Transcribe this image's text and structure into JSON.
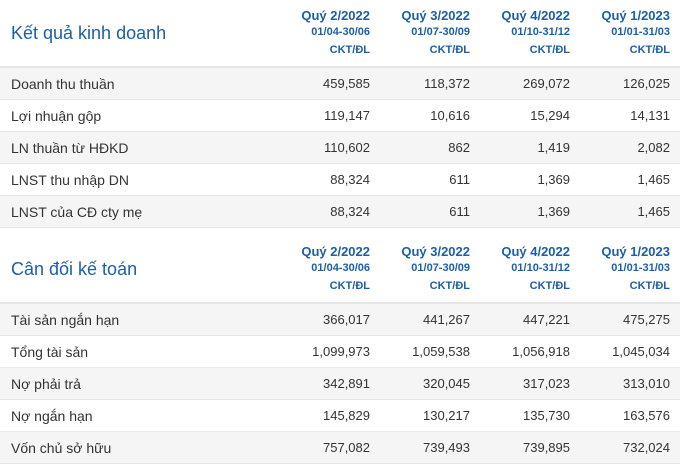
{
  "income": {
    "title": "Kết quả kinh doanh",
    "columns": [
      {
        "quarter": "Quý 2/2022",
        "dates": "01/04-30/06",
        "audit": "CKT/ĐL"
      },
      {
        "quarter": "Quý 3/2022",
        "dates": "01/07-30/09",
        "audit": "CKT/ĐL"
      },
      {
        "quarter": "Quý 4/2022",
        "dates": "01/10-31/12",
        "audit": "CKT/ĐL"
      },
      {
        "quarter": "Quý 1/2023",
        "dates": "01/01-31/03",
        "audit": "CKT/ĐL"
      }
    ],
    "rows": [
      {
        "label": "Doanh thu thuần",
        "values": [
          "459,585",
          "118,372",
          "269,072",
          "126,025"
        ]
      },
      {
        "label": "Lợi nhuận gộp",
        "values": [
          "119,147",
          "10,616",
          "15,294",
          "14,131"
        ]
      },
      {
        "label": "LN thuần từ HĐKD",
        "values": [
          "110,602",
          "862",
          "1,419",
          "2,082"
        ]
      },
      {
        "label": "LNST thu nhập DN",
        "values": [
          "88,324",
          "611",
          "1,369",
          "1,465"
        ]
      },
      {
        "label": "LNST của CĐ cty mẹ",
        "values": [
          "88,324",
          "611",
          "1,369",
          "1,465"
        ]
      }
    ]
  },
  "balance": {
    "title": "Cân đối kế toán",
    "columns": [
      {
        "quarter": "Quý 2/2022",
        "dates": "01/04-30/06",
        "audit": "CKT/ĐL"
      },
      {
        "quarter": "Quý 3/2022",
        "dates": "01/07-30/09",
        "audit": "CKT/ĐL"
      },
      {
        "quarter": "Quý 4/2022",
        "dates": "01/10-31/12",
        "audit": "CKT/ĐL"
      },
      {
        "quarter": "Quý 1/2023",
        "dates": "01/01-31/03",
        "audit": "CKT/ĐL"
      }
    ],
    "rows": [
      {
        "label": "Tài sản ngắn hạn",
        "values": [
          "366,017",
          "441,267",
          "447,221",
          "475,275"
        ]
      },
      {
        "label": "Tổng tài sản",
        "values": [
          "1,099,973",
          "1,059,538",
          "1,056,918",
          "1,045,034"
        ]
      },
      {
        "label": "Nợ phải trả",
        "values": [
          "342,891",
          "320,045",
          "317,023",
          "313,010"
        ]
      },
      {
        "label": "Nợ ngắn hạn",
        "values": [
          "145,829",
          "130,217",
          "135,730",
          "163,576"
        ]
      },
      {
        "label": "Vốn chủ sở hữu",
        "values": [
          "757,082",
          "739,493",
          "739,895",
          "732,024"
        ]
      }
    ]
  },
  "colors": {
    "accent": "#1c5fa8",
    "row_alt": "#f5f5f5",
    "divider": "#e6e6e6"
  }
}
